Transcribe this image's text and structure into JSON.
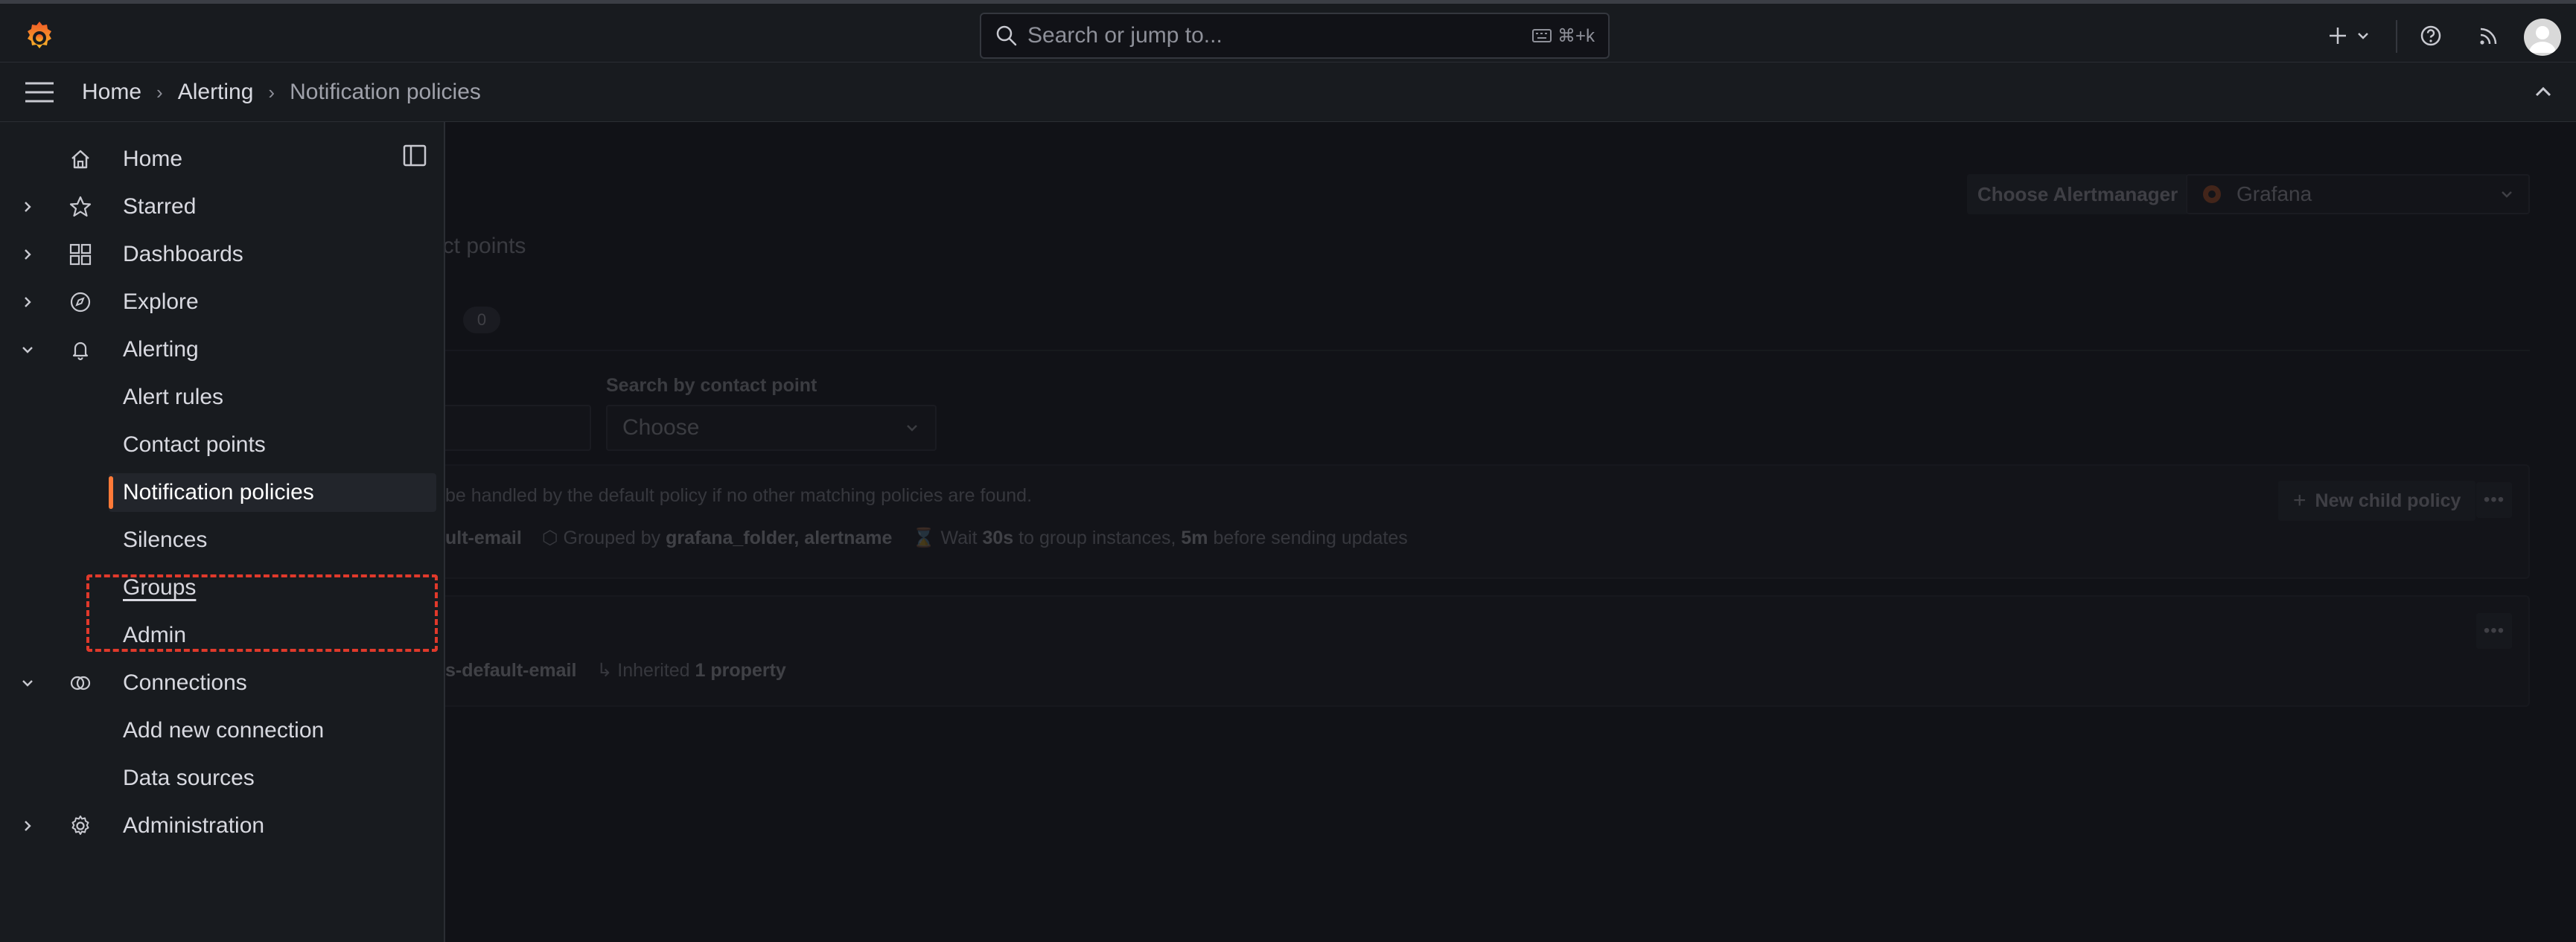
{
  "search": {
    "placeholder": "Search or jump to...",
    "shortcut": "⌘+k"
  },
  "breadcrumb": [
    {
      "label": "Home"
    },
    {
      "label": "Alerting"
    },
    {
      "label": "Notification policies"
    }
  ],
  "sidebar": {
    "items": [
      {
        "label": "Home",
        "icon": "home-icon",
        "expander": "none"
      },
      {
        "label": "Starred",
        "icon": "star-icon",
        "expander": "collapsed"
      },
      {
        "label": "Dashboards",
        "icon": "apps-icon",
        "expander": "collapsed"
      },
      {
        "label": "Explore",
        "icon": "compass-icon",
        "expander": "collapsed"
      },
      {
        "label": "Alerting",
        "icon": "bell-icon",
        "expander": "expanded"
      },
      {
        "label": "Alert rules",
        "sub": true
      },
      {
        "label": "Contact points",
        "sub": true
      },
      {
        "label": "Notification policies",
        "sub": true,
        "active": true
      },
      {
        "label": "Silences",
        "sub": true
      },
      {
        "label": "Groups",
        "sub": true,
        "underlined": true
      },
      {
        "label": "Admin",
        "sub": true
      },
      {
        "label": "Connections",
        "icon": "connections-icon",
        "expander": "expanded"
      },
      {
        "label": "Add new connection",
        "sub": true
      },
      {
        "label": "Data sources",
        "sub": true
      },
      {
        "label": "Administration",
        "icon": "cog-icon",
        "expander": "collapsed"
      }
    ]
  },
  "main": {
    "alertmanager_label": "Choose Alertmanager",
    "alertmanager_value": "Grafana",
    "tab_partial": "act points",
    "count_badge": "0",
    "contact_point_label": "Search by contact point",
    "contact_point_placeholder": "Choose",
    "default_policy": {
      "line1": "be handled by the default policy if no other matching policies are found.",
      "contact_partial": "ult-email",
      "grouped_by_prefix": "Grouped by",
      "grouped_by": "grafana_folder, alertname",
      "wait_prefix": "Wait",
      "wait_value": "30s",
      "wait_mid": "to group instances,",
      "repeat_value": "5m",
      "wait_suffix": "before sending updates",
      "new_child_label": "New child policy"
    },
    "child_policy": {
      "contact_partial": "s-default-email",
      "inherited_prefix": "Inherited",
      "inherited_value": "1 property"
    }
  },
  "colors": {
    "accent": "#ff7a38",
    "highlight": "#e0392b",
    "background": "#111217",
    "panel": "#181b1f"
  }
}
